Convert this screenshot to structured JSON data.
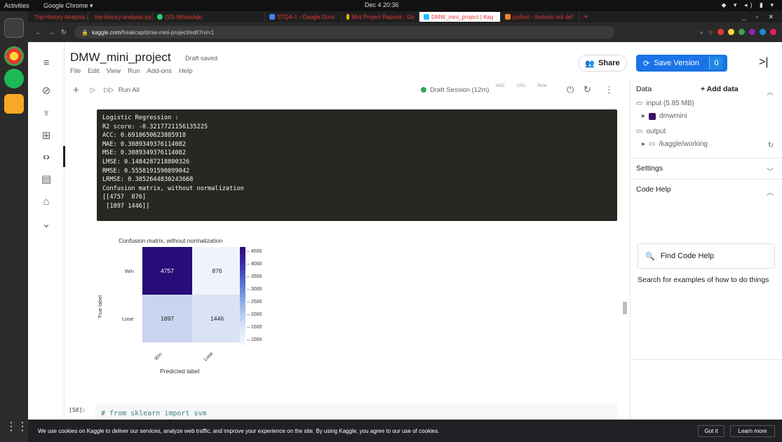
{
  "system": {
    "activities": "Activities",
    "app_name": "Google Chrome ▾",
    "clock": "Dec 4  20:36"
  },
  "tabs": [
    {
      "label": "Trip-History Analysis | Ka...",
      "color": "#4a90d9"
    },
    {
      "label": "trip-history-analysis.ipyn",
      "color": "#f6b400"
    },
    {
      "label": "(10) WhatsApp",
      "color": "#25d366"
    },
    {
      "label": "STQA-1 - Google Docs",
      "color": "#4285f4"
    },
    {
      "label": "Mini Project Reports - Go",
      "color": "#f4b400"
    },
    {
      "label": "DMW_mini_project | Kag",
      "color": "#20beff"
    },
    {
      "label": "python - itertools not def",
      "color": "#f48024"
    }
  ],
  "address": {
    "domain": "kaggle.com",
    "path": "/freakcap/dmw-mini-project/edit?rvi=1"
  },
  "notebook": {
    "title": "DMW_mini_project",
    "draft_status": "Draft saved",
    "menu": [
      "File",
      "Edit",
      "View",
      "Run",
      "Add-ons",
      "Help"
    ],
    "share_label": "Share",
    "save_label": "Save Version",
    "save_count": "0",
    "run_all": "Run All",
    "session": "Draft Session (12m)",
    "meters": [
      "HDD",
      "CPU",
      "RAM"
    ]
  },
  "output_lines": [
    "Logistic Regression :",
    "R2 score: -0.3217721156135225",
    "ACC: 0.6910650623885918",
    "MAE: 0.3089349376114082",
    "MSE: 0.3089349376114082",
    "LMSE: 0.1484287218800326",
    "RMSE: 0.5558191590899042",
    "LRMSE: 0.3852644830243668",
    "Confusion matrix, without normalization",
    "[[4757  876]",
    " [1897 1446]]"
  ],
  "chart_data": {
    "type": "heatmap",
    "title": "Confusion matrix, without normalization",
    "xlabel": "Predicted label",
    "ylabel": "True label",
    "x_categories": [
      "Win",
      "Lose"
    ],
    "y_categories": [
      "Win",
      "Lose"
    ],
    "values": [
      [
        4757,
        876
      ],
      [
        1897,
        1446
      ]
    ],
    "colorbar_ticks": [
      "4500",
      "4000",
      "3500",
      "3000",
      "2500",
      "2000",
      "1500",
      "1000"
    ],
    "colormap": "Purples-Blues"
  },
  "next_cell": {
    "prompt": "[58]:",
    "code": "# from sklearn import svm"
  },
  "right_panel": {
    "data_title": "Data",
    "add_data": "+ Add data",
    "input_label": "input (5.85 MB)",
    "dataset": "dmwmini",
    "output_label": "output",
    "working": "/kaggle/working",
    "settings": "Settings",
    "code_help": "Code Help",
    "find_help": "Find Code Help",
    "search_examples": "Search for examples of how to do things"
  },
  "cookie": {
    "text": "We use cookies on Kaggle to deliver our services, analyze web traffic, and improve your experience on the site. By using Kaggle, you agree to our use of cookies.",
    "got_it": "Got it",
    "learn_more": "Learn more"
  }
}
